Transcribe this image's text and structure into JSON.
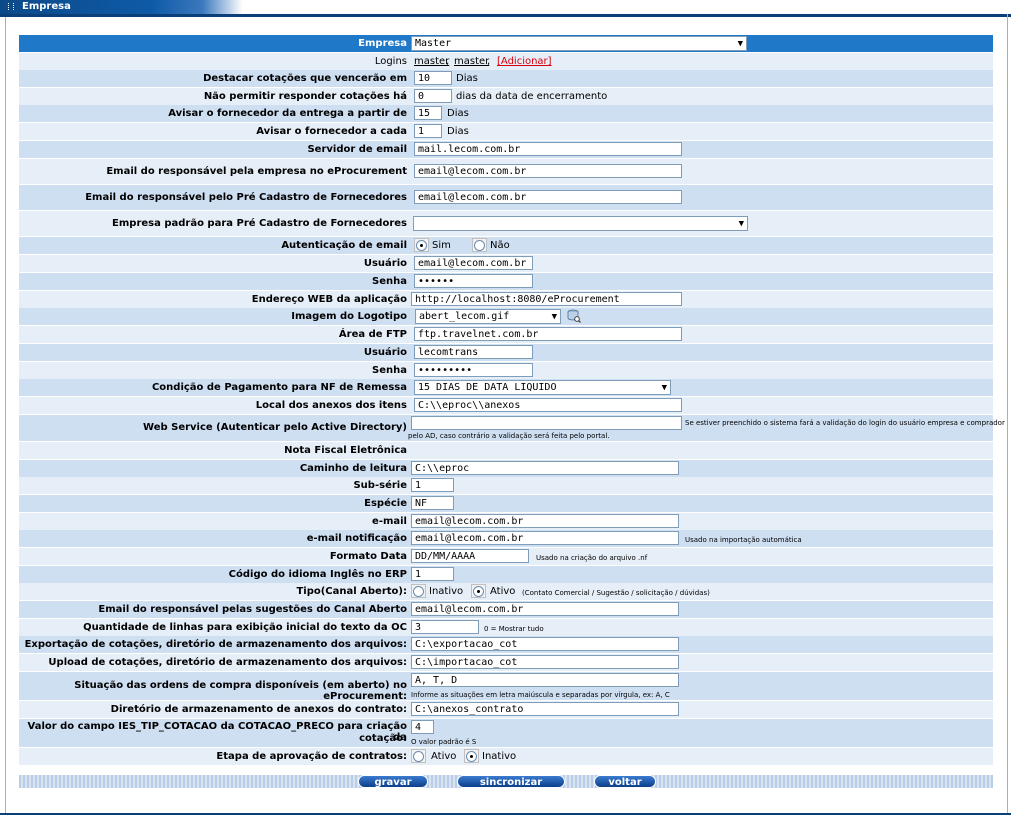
{
  "window": {
    "title": "Empresa"
  },
  "form": {
    "empresa": {
      "label": "Empresa",
      "value": "Master"
    },
    "logins": {
      "label": "Logins",
      "items": [
        "master",
        "master"
      ],
      "add": "[Adicionar]"
    },
    "destacar": {
      "label": "Destacar cotações que vencerão em",
      "value": "10",
      "suffix": "Dias"
    },
    "nao_permitir": {
      "label": "Não permitir responder cotações há",
      "value": "0",
      "suffix": "dias da data de encerramento"
    },
    "avisar_entrega": {
      "label": "Avisar o fornecedor da entrega a partir de",
      "value": "15",
      "suffix": "Dias"
    },
    "avisar_cada": {
      "label": "Avisar o fornecedor a cada",
      "value": "1",
      "suffix": "Dias"
    },
    "servidor_email": {
      "label": "Servidor de email",
      "value": "mail.lecom.com.br"
    },
    "email_eprocurement": {
      "label": "Email do responsável pela empresa no eProcurement",
      "value": "email@lecom.com.br"
    },
    "email_precadastro": {
      "label": "Email do responsável pelo Pré Cadastro de Fornecedores",
      "value": "email@lecom.com.br"
    },
    "empresa_padrao": {
      "label": "Empresa padrão para Pré Cadastro de Fornecedores",
      "value": ""
    },
    "autenticacao": {
      "label": "Autenticação de email",
      "opt_yes": "Sim",
      "opt_no": "Não",
      "selected": "Sim"
    },
    "usuario": {
      "label": "Usuário",
      "value": "email@lecom.com.br"
    },
    "senha": {
      "label": "Senha",
      "value": "••••••"
    },
    "endereco_web": {
      "label": "Endereço WEB da aplicação",
      "value": "http://localhost:8080/eProcurement"
    },
    "logotipo": {
      "label": "Imagem do Logotipo",
      "value": "abert_lecom.gif",
      "icon": "database-search-icon"
    },
    "ftp": {
      "label": "Área de FTP",
      "value": "ftp.travelnet.com.br"
    },
    "usuario_ftp": {
      "label": "Usuário",
      "value": "lecomtrans"
    },
    "senha_ftp": {
      "label": "Senha",
      "value": "•••••••••"
    },
    "condicao_pagamento": {
      "label": "Condição de Pagamento para NF de Remessa",
      "value": "15 DIAS DE DATA LIQUIDO"
    },
    "local_anexos": {
      "label": "Local dos anexos dos itens",
      "value": "C:\\\\eproc\\\\anexos"
    },
    "webservice": {
      "label": "Web Service (Autenticar pelo Active Directory)",
      "value": "",
      "hint1": "Se estiver preenchido o sistema fará a validação do login do usuário empresa e comprador",
      "hint2": "pelo AD, caso contrário a validação será feita pelo portal."
    },
    "nota_fiscal": {
      "label": "Nota Fiscal Eletrônica"
    },
    "caminho_leitura": {
      "label": "Caminho de leitura",
      "value": "C:\\\\eproc"
    },
    "sub_serie": {
      "label": "Sub-série",
      "value": "1"
    },
    "especie": {
      "label": "Espécie",
      "value": "NF"
    },
    "email": {
      "label": "e-mail",
      "value": "email@lecom.com.br"
    },
    "email_notificacao": {
      "label": "e-mail notificação",
      "value": "email@lecom.com.br",
      "hint": "Usado na importação automática"
    },
    "formato_data": {
      "label": "Formato Data",
      "value": "DD/MM/AAAA",
      "hint": "Usado na criação do arquivo .nf"
    },
    "codigo_idioma": {
      "label": "Código do idioma Inglês no ERP",
      "value": "1"
    },
    "tipo_canal": {
      "label": "Tipo(Canal Aberto):",
      "opt_inativo": "Inativo",
      "opt_ativo": "Ativo",
      "ativo_hint": "(Contato Comercial / Sugestão / solicitação / dúvidas)",
      "selected": "Ativo"
    },
    "email_sugestoes": {
      "label": "Email do responsável pelas sugestões do Canal Aberto",
      "value": "email@lecom.com.br"
    },
    "qtd_linhas": {
      "label": "Quantidade de linhas para exibição inicial do texto da OC",
      "value": "3",
      "hint": "0 = Mostrar tudo"
    },
    "exportacao": {
      "label": "Exportação de cotações, diretório de armazenamento dos arquivos:",
      "value": "C:\\exportacao_cot"
    },
    "upload": {
      "label": "Upload de cotações, diretório de armazenamento dos arquivos:",
      "value": "C:\\importacao_cot"
    },
    "situacao": {
      "label": "Situação das ordens de compra disponíveis (em aberto) no eProcurement:",
      "value": "A, T, D",
      "hint": "Informe as situações em letra maiúscula e separadas por vírgula, ex: A, C"
    },
    "diretorio_contrato": {
      "label": "Diretório de armazenamento de anexos do contrato:",
      "value": "C:\\anexos_contrato"
    },
    "valor_campo": {
      "label1": "Valor do campo IES_TIP_COTACAO da COTACAO_PRECO para criação da",
      "label2": "cotação:",
      "value": "4",
      "hint": "O valor padrão é S"
    },
    "etapa": {
      "label": "Etapa de aprovação de contratos:",
      "opt_ativo": "Ativo",
      "opt_inativo": "Inativo",
      "selected": "Inativo"
    }
  },
  "buttons": {
    "gravar": "gravar",
    "sincronizar": "sincronizar",
    "voltar": "voltar"
  }
}
